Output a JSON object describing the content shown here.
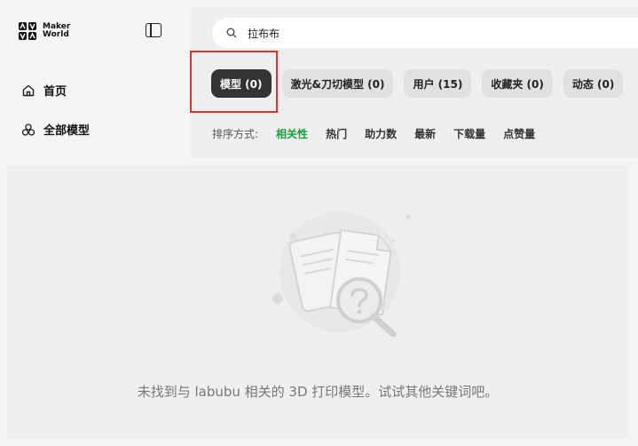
{
  "brand": {
    "line1": "Maker",
    "line2": "World"
  },
  "sidebar": {
    "items": [
      {
        "label": "首页",
        "icon": "home-icon"
      },
      {
        "label": "全部模型",
        "icon": "models-icon"
      }
    ]
  },
  "search": {
    "value": "拉布布",
    "icon": "search-icon"
  },
  "tabs": [
    {
      "label": "模型 (0)",
      "active": true
    },
    {
      "label": "激光&刀切模型 (0)",
      "active": false
    },
    {
      "label": "用户 (15)",
      "active": false
    },
    {
      "label": "收藏夹 (0)",
      "active": false
    },
    {
      "label": "动态 (0)",
      "active": false
    }
  ],
  "sort": {
    "label": "排序方式:",
    "options": [
      "相关性",
      "热门",
      "助力数",
      "最新",
      "下载量",
      "点赞量"
    ],
    "active_index": 0
  },
  "empty_state": {
    "message": "未找到与 labubu 相关的 3D 打印模型。试试其他关键词吧。"
  },
  "colors": {
    "accent_green": "#13a33b",
    "highlight_red": "#e0322c",
    "active_tab_bg": "#333333"
  }
}
